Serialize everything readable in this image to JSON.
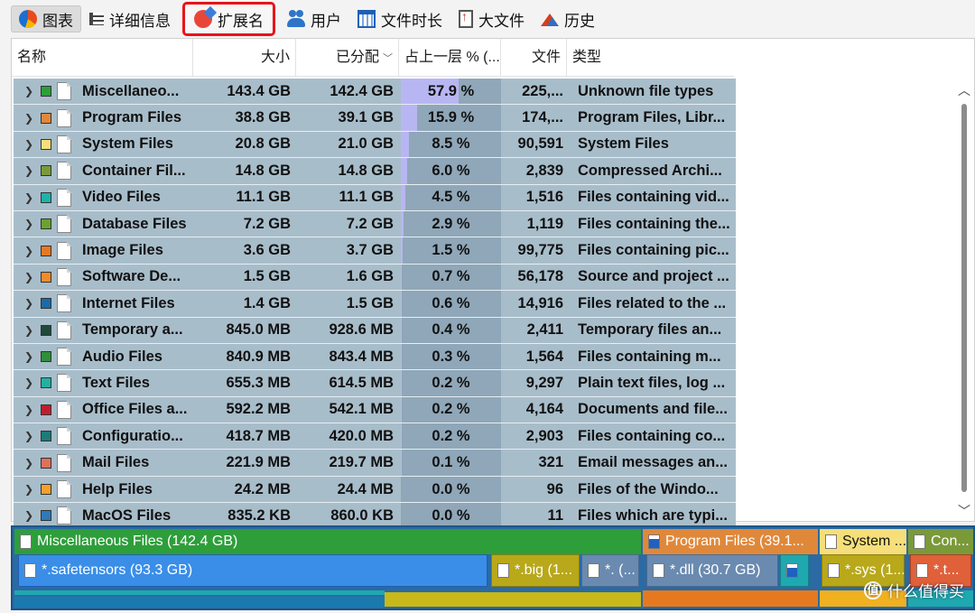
{
  "toolbar": {
    "tabs": [
      {
        "label": "图表",
        "icon": "pie-chart-icon"
      },
      {
        "label": "详细信息",
        "icon": "list-icon"
      },
      {
        "label": "扩展名",
        "icon": "extension-icon"
      },
      {
        "label": "用户",
        "icon": "users-icon"
      },
      {
        "label": "文件时长",
        "icon": "calendar-icon"
      },
      {
        "label": "大文件",
        "icon": "big-file-icon"
      },
      {
        "label": "历史",
        "icon": "history-icon"
      }
    ]
  },
  "table": {
    "headers": {
      "name": "名称",
      "size": "大小",
      "allocated": "已分配",
      "percent": "占上一层 % (...",
      "files": "文件",
      "type": "类型"
    },
    "rows": [
      {
        "name": "Miscellaneo...",
        "size": "143.4 GB",
        "allocated": "142.4 GB",
        "percent": "57.9 %",
        "pct": 57.9,
        "files": "225,...",
        "type": "Unknown file types",
        "color": "#2e9e3a"
      },
      {
        "name": "Program Files",
        "size": "38.8 GB",
        "allocated": "39.1 GB",
        "percent": "15.9 %",
        "pct": 15.9,
        "files": "174,...",
        "type": "Program Files, Libr...",
        "color": "#e0883a"
      },
      {
        "name": "System Files",
        "size": "20.8 GB",
        "allocated": "21.0 GB",
        "percent": "8.5 %",
        "pct": 8.5,
        "files": "90,591",
        "type": "System Files",
        "color": "#f6df7a"
      },
      {
        "name": "Container Fil...",
        "size": "14.8 GB",
        "allocated": "14.8 GB",
        "percent": "6.0 %",
        "pct": 6.0,
        "files": "2,839",
        "type": "Compressed Archi...",
        "color": "#7a9a3a"
      },
      {
        "name": "Video Files",
        "size": "11.1 GB",
        "allocated": "11.1 GB",
        "percent": "4.5 %",
        "pct": 4.5,
        "files": "1,516",
        "type": "Files containing vid...",
        "color": "#1fb2a8"
      },
      {
        "name": "Database Files",
        "size": "7.2 GB",
        "allocated": "7.2 GB",
        "percent": "2.9 %",
        "pct": 2.9,
        "files": "1,119",
        "type": "Files containing the...",
        "color": "#6aa32e"
      },
      {
        "name": "Image Files",
        "size": "3.6 GB",
        "allocated": "3.7 GB",
        "percent": "1.5 %",
        "pct": 1.5,
        "files": "99,775",
        "type": "Files containing pic...",
        "color": "#e6791f"
      },
      {
        "name": "Software De...",
        "size": "1.5 GB",
        "allocated": "1.6 GB",
        "percent": "0.7 %",
        "pct": 0.7,
        "files": "56,178",
        "type": "Source and project ...",
        "color": "#f08a2a"
      },
      {
        "name": "Internet Files",
        "size": "1.4 GB",
        "allocated": "1.5 GB",
        "percent": "0.6 %",
        "pct": 0.6,
        "files": "14,916",
        "type": "Files related to the ...",
        "color": "#1a6aa8"
      },
      {
        "name": "Temporary a...",
        "size": "845.0 MB",
        "allocated": "928.6 MB",
        "percent": "0.4 %",
        "pct": 0.4,
        "files": "2,411",
        "type": "Temporary files an...",
        "color": "#1f4a3a"
      },
      {
        "name": "Audio Files",
        "size": "840.9 MB",
        "allocated": "843.4 MB",
        "percent": "0.3 %",
        "pct": 0.3,
        "files": "1,564",
        "type": "Files containing m...",
        "color": "#2f8f3a"
      },
      {
        "name": "Text Files",
        "size": "655.3 MB",
        "allocated": "614.5 MB",
        "percent": "0.2 %",
        "pct": 0.2,
        "files": "9,297",
        "type": "Plain text files, log ...",
        "color": "#24b0a0"
      },
      {
        "name": "Office Files a...",
        "size": "592.2 MB",
        "allocated": "542.1 MB",
        "percent": "0.2 %",
        "pct": 0.2,
        "files": "4,164",
        "type": "Documents and file...",
        "color": "#c01e2e"
      },
      {
        "name": "Configuratio...",
        "size": "418.7 MB",
        "allocated": "420.0 MB",
        "percent": "0.2 %",
        "pct": 0.2,
        "files": "2,903",
        "type": "Files containing co...",
        "color": "#1c7a78"
      },
      {
        "name": "Mail Files",
        "size": "221.9 MB",
        "allocated": "219.7 MB",
        "percent": "0.1 %",
        "pct": 0.1,
        "files": "321",
        "type": "Email messages an...",
        "color": "#e0705a"
      },
      {
        "name": "Help Files",
        "size": "24.2 MB",
        "allocated": "24.4 MB",
        "percent": "0.0 %",
        "pct": 0.0,
        "files": "96",
        "type": "Files of the Windo...",
        "color": "#f5a02a"
      },
      {
        "name": "MacOS Files",
        "size": "835.2 KB",
        "allocated": "860.0 KB",
        "percent": "0.0 %",
        "pct": 0.0,
        "files": "11",
        "type": "Files which are typi...",
        "color": "#2e7ab8"
      }
    ]
  },
  "treemap": {
    "misc": "Miscellaneous Files (142.4 GB)",
    "safetensors": "*.safetensors (93.3 GB)",
    "big": "*.big (1...",
    "misc_other": "*. (...",
    "program": "Program Files (39.1...",
    "dll": "*.dll (30.7 GB)",
    "system": "System ...",
    "sys": "*.sys (1...",
    "container": "Con...",
    "container_sub": "*.t..."
  },
  "watermark": "什么值得买"
}
